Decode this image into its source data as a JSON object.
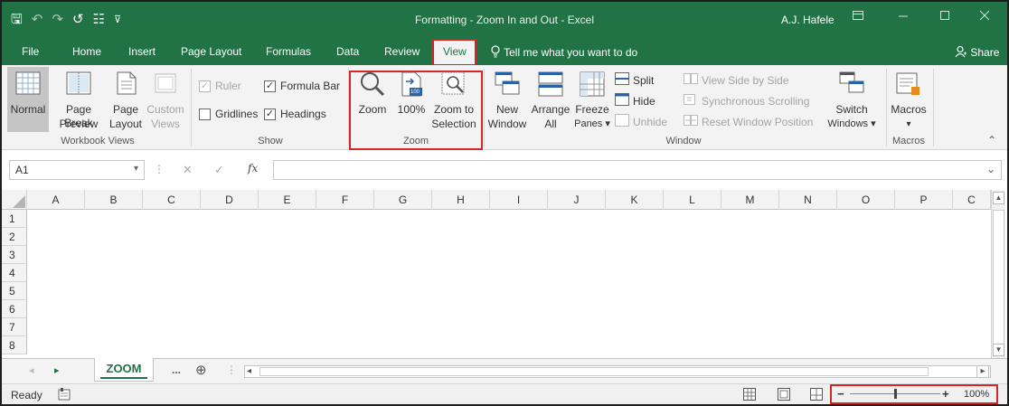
{
  "title_bar": {
    "title": "Formatting - Zoom In and Out  -  Excel",
    "user": "A.J. Hafele",
    "qat_glyphs": {
      "save": "🖫",
      "undo": "↶",
      "redo": "↷",
      "refresh": "↺",
      "form": "☷",
      "customize": "⊽"
    }
  },
  "ribbon_tabs": {
    "tabs": [
      "File",
      "Home",
      "Insert",
      "Page Layout",
      "Formulas",
      "Data",
      "Review",
      "View"
    ],
    "active": "View",
    "tell_me": "Tell me what you want to do",
    "share": "Share"
  },
  "ribbon": {
    "workbook_views": {
      "label": "Workbook Views",
      "normal": "Normal",
      "page_break_line1": "Page Break",
      "page_break_line2": "Preview",
      "page_layout_line1": "Page",
      "page_layout_line2": "Layout",
      "custom_views_line1": "Custom",
      "custom_views_line2": "Views"
    },
    "show": {
      "label": "Show",
      "ruler": "Ruler",
      "formula_bar": "Formula Bar",
      "gridlines": "Gridlines",
      "headings": "Headings",
      "check_mark": "✓"
    },
    "zoom": {
      "label": "Zoom",
      "zoom": "Zoom",
      "hundred": "100%",
      "hundred_icon": "100",
      "selection_line1": "Zoom to",
      "selection_line2": "Selection"
    },
    "window": {
      "label": "Window",
      "new_line1": "New",
      "new_line2": "Window",
      "arrange_line1": "Arrange",
      "arrange_line2": "All",
      "freeze_line1": "Freeze",
      "freeze_line2": "Panes ▾",
      "split": "Split",
      "hide": "Hide",
      "unhide": "Unhide",
      "side_by_side": "View Side by Side",
      "sync_scroll": "Synchronous Scrolling",
      "reset_pos": "Reset Window Position",
      "switch_line1": "Switch",
      "switch_line2": "Windows ▾"
    },
    "macros": {
      "label": "Macros",
      "macros": "Macros",
      "dropdown": "▾"
    },
    "collapse_glyph": "⌃"
  },
  "formula_bar": {
    "name_box": "A1",
    "dropdown": "▾",
    "dots": "⋮",
    "cancel": "✕",
    "enter": "✓",
    "fx": "fx",
    "expand": "⌄"
  },
  "grid": {
    "columns": [
      "A",
      "B",
      "C",
      "D",
      "E",
      "F",
      "G",
      "H",
      "I",
      "J",
      "K",
      "L",
      "M",
      "N",
      "O",
      "P",
      "C"
    ],
    "rows": [
      "1",
      "2",
      "3",
      "4",
      "5",
      "6",
      "7",
      "8"
    ]
  },
  "sheet_bar": {
    "prev": "◂",
    "next": "▸",
    "sheet": "ZOOM",
    "ellipsis": "...",
    "add": "⊕",
    "dots": "⋮",
    "scroll_left": "◂",
    "scroll_right": "▸"
  },
  "status_bar": {
    "ready": "Ready",
    "zoom_minus": "−",
    "zoom_plus": "+",
    "zoom_level": "100%",
    "zoom_fraction": 0.5
  },
  "colors": {
    "excel_green": "#217346",
    "highlight": "#d32626"
  }
}
